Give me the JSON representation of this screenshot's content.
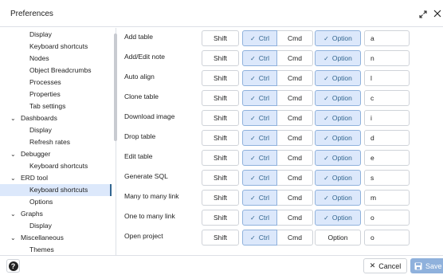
{
  "window": {
    "title": "Preferences"
  },
  "sidebar": {
    "items": [
      {
        "label": "Display",
        "level": 1,
        "caret": ""
      },
      {
        "label": "Keyboard shortcuts",
        "level": 1,
        "caret": ""
      },
      {
        "label": "Nodes",
        "level": 1,
        "caret": ""
      },
      {
        "label": "Object Breadcrumbs",
        "level": 1,
        "caret": ""
      },
      {
        "label": "Processes",
        "level": 1,
        "caret": ""
      },
      {
        "label": "Properties",
        "level": 1,
        "caret": ""
      },
      {
        "label": "Tab settings",
        "level": 1,
        "caret": ""
      },
      {
        "label": "Dashboards",
        "level": 0,
        "caret": "⌄"
      },
      {
        "label": "Display",
        "level": 1,
        "caret": ""
      },
      {
        "label": "Refresh rates",
        "level": 1,
        "caret": ""
      },
      {
        "label": "Debugger",
        "level": 0,
        "caret": "⌄"
      },
      {
        "label": "Keyboard shortcuts",
        "level": 1,
        "caret": ""
      },
      {
        "label": "ERD tool",
        "level": 0,
        "caret": "⌄"
      },
      {
        "label": "Keyboard shortcuts",
        "level": 1,
        "caret": "",
        "selected": true
      },
      {
        "label": "Options",
        "level": 1,
        "caret": ""
      },
      {
        "label": "Graphs",
        "level": 0,
        "caret": "⌄"
      },
      {
        "label": "Display",
        "level": 1,
        "caret": ""
      },
      {
        "label": "Miscellaneous",
        "level": 0,
        "caret": "⌄"
      },
      {
        "label": "Themes",
        "level": 1,
        "caret": ""
      }
    ]
  },
  "modifier_labels": {
    "shift": "Shift",
    "ctrl": "Ctrl",
    "cmd": "Cmd",
    "option": "Option"
  },
  "shortcuts": [
    {
      "label": "Add table",
      "shift": false,
      "ctrl": true,
      "cmd": false,
      "option": true,
      "key": "a"
    },
    {
      "label": "Add/Edit note",
      "shift": false,
      "ctrl": true,
      "cmd": false,
      "option": true,
      "key": "n"
    },
    {
      "label": "Auto align",
      "shift": false,
      "ctrl": true,
      "cmd": false,
      "option": true,
      "key": "l"
    },
    {
      "label": "Clone table",
      "shift": false,
      "ctrl": true,
      "cmd": false,
      "option": true,
      "key": "c"
    },
    {
      "label": "Download image",
      "shift": false,
      "ctrl": true,
      "cmd": false,
      "option": true,
      "key": "i"
    },
    {
      "label": "Drop table",
      "shift": false,
      "ctrl": true,
      "cmd": false,
      "option": true,
      "key": "d"
    },
    {
      "label": "Edit table",
      "shift": false,
      "ctrl": true,
      "cmd": false,
      "option": true,
      "key": "e"
    },
    {
      "label": "Generate SQL",
      "shift": false,
      "ctrl": true,
      "cmd": false,
      "option": true,
      "key": "s"
    },
    {
      "label": "Many to many link",
      "shift": false,
      "ctrl": true,
      "cmd": false,
      "option": true,
      "key": "m"
    },
    {
      "label": "One to many link",
      "shift": false,
      "ctrl": true,
      "cmd": false,
      "option": true,
      "key": "o"
    },
    {
      "label": "Open project",
      "shift": false,
      "ctrl": true,
      "cmd": false,
      "option": false,
      "key": "o"
    }
  ],
  "footer": {
    "help_label": "?",
    "cancel_label": "Cancel",
    "save_label": "Save"
  },
  "icons": {
    "expand": "expand-icon",
    "close": "close-icon",
    "check": "check-icon",
    "help": "help-icon",
    "cancel": "close-icon",
    "save": "save-icon"
  },
  "colors": {
    "accent": "#326690",
    "selected_bg": "#dce8fb",
    "save_disabled": "#8fb1dc",
    "border": "#cfd3d9"
  }
}
